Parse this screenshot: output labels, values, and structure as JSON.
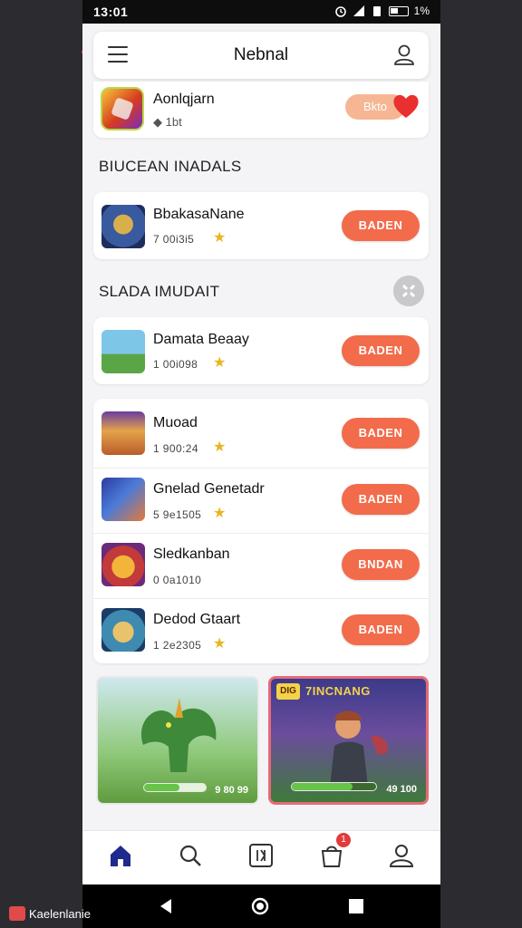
{
  "status_bar": {
    "time": "13:01",
    "battery": "1%"
  },
  "header": {
    "title": "Nebnal"
  },
  "featured": {
    "name": "Aonlqjarn",
    "sub": "◆ 1bt",
    "button": "Bkto"
  },
  "sections": {
    "first_title": "BIUCEAN INADALS",
    "second_title": "SLADA IMUDAIT"
  },
  "list1": [
    {
      "name": "BbakasaNane",
      "sub": "7 00i3i5",
      "button": "BADEN"
    }
  ],
  "list2": [
    {
      "name": "Damata Beaay",
      "sub": "1 00i098",
      "button": "BADEN"
    }
  ],
  "list3": [
    {
      "name": "Muoad",
      "sub": "1 900:24",
      "button": "BADEN"
    },
    {
      "name": "Gnelad Genetadr",
      "sub": "5 9e1505",
      "button": "BADEN"
    },
    {
      "name": "Sledkanban",
      "sub": "0 0a1010",
      "button": "BNDAN"
    },
    {
      "name": "Dedod Gtaart",
      "sub": "1 2e2305",
      "button": "BADEN"
    }
  ],
  "promos": [
    {
      "name": "dragon-promo",
      "tag": "",
      "heading": "",
      "count": "9 80 99",
      "progress": 0.58
    },
    {
      "name": "arena-promo",
      "tag": "DIG",
      "heading": "7INCNANG",
      "count": "49 100",
      "progress": 0.72
    }
  ],
  "bottom_nav": [
    {
      "name": "home",
      "active": true
    },
    {
      "name": "search"
    },
    {
      "name": "library"
    },
    {
      "name": "cart",
      "badge": "1"
    },
    {
      "name": "account"
    }
  ],
  "watermark": "Kaelenlanie",
  "colors": {
    "accent": "#f26b4b",
    "nav_active": "#1e2a8c",
    "star": "#e8b521"
  }
}
